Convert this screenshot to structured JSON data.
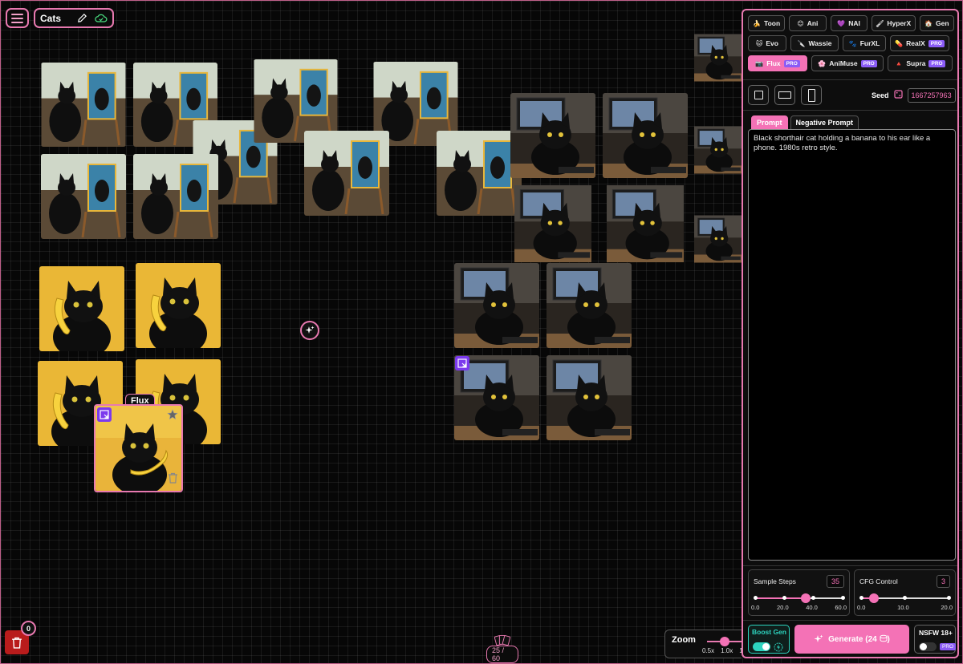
{
  "project": {
    "title": "Cats"
  },
  "canvas": {
    "selected_tile": {
      "model_label": "Flux"
    },
    "trash_count": "0",
    "card_counter": "25 / 60"
  },
  "zoom": {
    "label": "Zoom",
    "ticks": [
      "0.5x",
      "1.0x",
      "1.5"
    ]
  },
  "models": [
    [
      {
        "label": "Toon",
        "icon": "🍌"
      },
      {
        "label": "Ani",
        "icon": "😊"
      },
      {
        "label": "NAI",
        "icon": "💜"
      },
      {
        "label": "HyperX",
        "icon": "🖌"
      },
      {
        "label": "Gen",
        "icon": "🏠"
      }
    ],
    [
      {
        "label": "Evo",
        "icon": "🐱"
      },
      {
        "label": "Wassie",
        "icon": "🔪"
      },
      {
        "label": "FurXL",
        "icon": "🐾"
      },
      {
        "label": "RealX",
        "icon": "💊",
        "pro": "PRO"
      }
    ],
    [
      {
        "label": "Flux",
        "icon": "📷",
        "pro": "PRO",
        "active": true
      },
      {
        "label": "AniMuse",
        "icon": "🌸",
        "pro": "PRO"
      },
      {
        "label": "Supra",
        "icon": "🔺",
        "pro": "PRO"
      }
    ]
  ],
  "seed": {
    "label": "Seed",
    "value": "1667257963"
  },
  "tabs": {
    "prompt": "Prompt",
    "negative": "Negative Prompt"
  },
  "prompt": {
    "text": "Black shorthair cat holding a banana to his ear like a phone. 1980s retro style."
  },
  "sample_steps": {
    "label": "Sample Steps",
    "value": "35",
    "ticks": [
      "0.0",
      "20.0",
      "40.0",
      "60.0"
    ],
    "fraction": 0.58
  },
  "cfg": {
    "label": "CFG Control",
    "value": "3",
    "ticks": [
      "0.0",
      "10.0",
      "20.0"
    ],
    "fraction": 0.15
  },
  "boost": {
    "label": "Boost Gen"
  },
  "generate": {
    "label": "Generate (24",
    "suffix": ")"
  },
  "nsfw": {
    "label": "NSFW 18+",
    "pro": "PRO"
  }
}
